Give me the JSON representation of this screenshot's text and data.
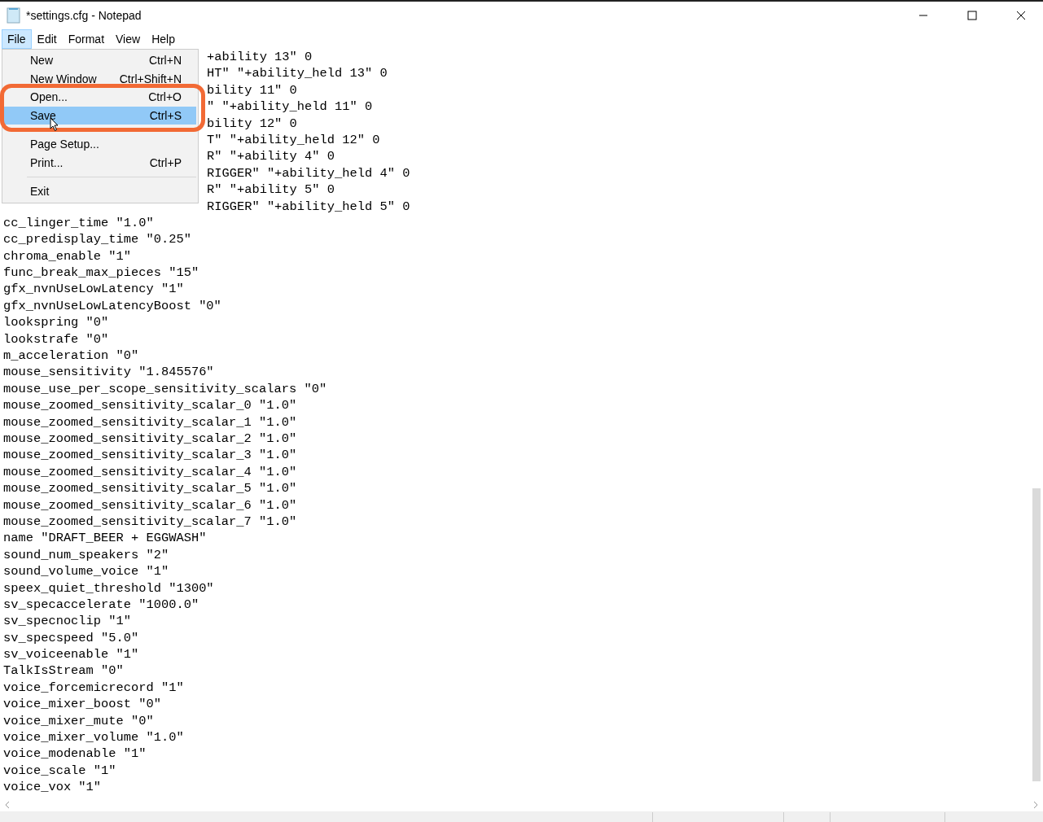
{
  "window": {
    "title": "*settings.cfg - Notepad"
  },
  "menu_bar": [
    {
      "label": "File",
      "selected": true
    },
    {
      "label": "Edit",
      "selected": false
    },
    {
      "label": "Format",
      "selected": false
    },
    {
      "label": "View",
      "selected": false
    },
    {
      "label": "Help",
      "selected": false
    }
  ],
  "file_menu": [
    {
      "kind": "item",
      "label": "New",
      "shortcut": "Ctrl+N",
      "selected": false
    },
    {
      "kind": "item",
      "label": "New Window",
      "shortcut": "Ctrl+Shift+N",
      "selected": false
    },
    {
      "kind": "item",
      "label": "Open...",
      "shortcut": "Ctrl+O",
      "selected": false
    },
    {
      "kind": "item",
      "label": "Save",
      "shortcut": "Ctrl+S",
      "selected": true
    },
    {
      "kind": "separator"
    },
    {
      "kind": "item",
      "label": "Page Setup...",
      "selected": false
    },
    {
      "kind": "item",
      "label": "Print...",
      "shortcut": "Ctrl+P",
      "selected": false
    },
    {
      "kind": "separator"
    },
    {
      "kind": "item",
      "label": "Exit",
      "selected": false
    }
  ],
  "editor": {
    "lines": [
      {
        "kind": "partial",
        "text": "+ability 13\" 0"
      },
      {
        "kind": "partial",
        "text": "HT\" \"+ability_held 13\" 0"
      },
      {
        "kind": "partial",
        "text": "bility 11\" 0"
      },
      {
        "kind": "partial",
        "text": "\" \"+ability_held 11\" 0"
      },
      {
        "kind": "partial",
        "text": "bility 12\" 0"
      },
      {
        "kind": "partial",
        "text": "T\" \"+ability_held 12\" 0"
      },
      {
        "kind": "partial",
        "text": "R\" \"+ability 4\" 0"
      },
      {
        "kind": "partial",
        "text": "RIGGER\" \"+ability_held 4\" 0"
      },
      {
        "kind": "partial",
        "text": "R\" \"+ability 5\" 0"
      },
      {
        "kind": "partial",
        "text": "RIGGER\" \"+ability_held 5\" 0"
      },
      {
        "kind": "full",
        "text": "cc_linger_time \"1.0\""
      },
      {
        "kind": "full",
        "text": "cc_predisplay_time \"0.25\""
      },
      {
        "kind": "full",
        "text": "chroma_enable \"1\""
      },
      {
        "kind": "full",
        "text": "func_break_max_pieces \"15\""
      },
      {
        "kind": "full",
        "text": "gfx_nvnUseLowLatency \"1\""
      },
      {
        "kind": "full",
        "text": "gfx_nvnUseLowLatencyBoost \"0\""
      },
      {
        "kind": "full",
        "text": "lookspring \"0\""
      },
      {
        "kind": "full",
        "text": "lookstrafe \"0\""
      },
      {
        "kind": "full",
        "text": "m_acceleration \"0\""
      },
      {
        "kind": "full",
        "text": "mouse_sensitivity \"1.845576\""
      },
      {
        "kind": "full",
        "text": "mouse_use_per_scope_sensitivity_scalars \"0\""
      },
      {
        "kind": "full",
        "text": "mouse_zoomed_sensitivity_scalar_0 \"1.0\""
      },
      {
        "kind": "full",
        "text": "mouse_zoomed_sensitivity_scalar_1 \"1.0\""
      },
      {
        "kind": "full",
        "text": "mouse_zoomed_sensitivity_scalar_2 \"1.0\""
      },
      {
        "kind": "full",
        "text": "mouse_zoomed_sensitivity_scalar_3 \"1.0\""
      },
      {
        "kind": "full",
        "text": "mouse_zoomed_sensitivity_scalar_4 \"1.0\""
      },
      {
        "kind": "full",
        "text": "mouse_zoomed_sensitivity_scalar_5 \"1.0\""
      },
      {
        "kind": "full",
        "text": "mouse_zoomed_sensitivity_scalar_6 \"1.0\""
      },
      {
        "kind": "full",
        "text": "mouse_zoomed_sensitivity_scalar_7 \"1.0\""
      },
      {
        "kind": "full",
        "text": "name \"DRAFT_BEER + EGGWASH\""
      },
      {
        "kind": "full",
        "text": "sound_num_speakers \"2\""
      },
      {
        "kind": "full",
        "text": "sound_volume_voice \"1\""
      },
      {
        "kind": "full",
        "text": "speex_quiet_threshold \"1300\""
      },
      {
        "kind": "full",
        "text": "sv_specaccelerate \"1000.0\""
      },
      {
        "kind": "full",
        "text": "sv_specnoclip \"1\""
      },
      {
        "kind": "full",
        "text": "sv_specspeed \"5.0\""
      },
      {
        "kind": "full",
        "text": "sv_voiceenable \"1\""
      },
      {
        "kind": "full",
        "text": "TalkIsStream \"0\""
      },
      {
        "kind": "full",
        "text": "voice_forcemicrecord \"1\""
      },
      {
        "kind": "full",
        "text": "voice_mixer_boost \"0\""
      },
      {
        "kind": "full",
        "text": "voice_mixer_mute \"0\""
      },
      {
        "kind": "full",
        "text": "voice_mixer_volume \"1.0\""
      },
      {
        "kind": "full",
        "text": "voice_modenable \"1\""
      },
      {
        "kind": "full",
        "text": "voice_scale \"1\""
      },
      {
        "kind": "full",
        "text": "voice_vox \"1\""
      }
    ]
  }
}
